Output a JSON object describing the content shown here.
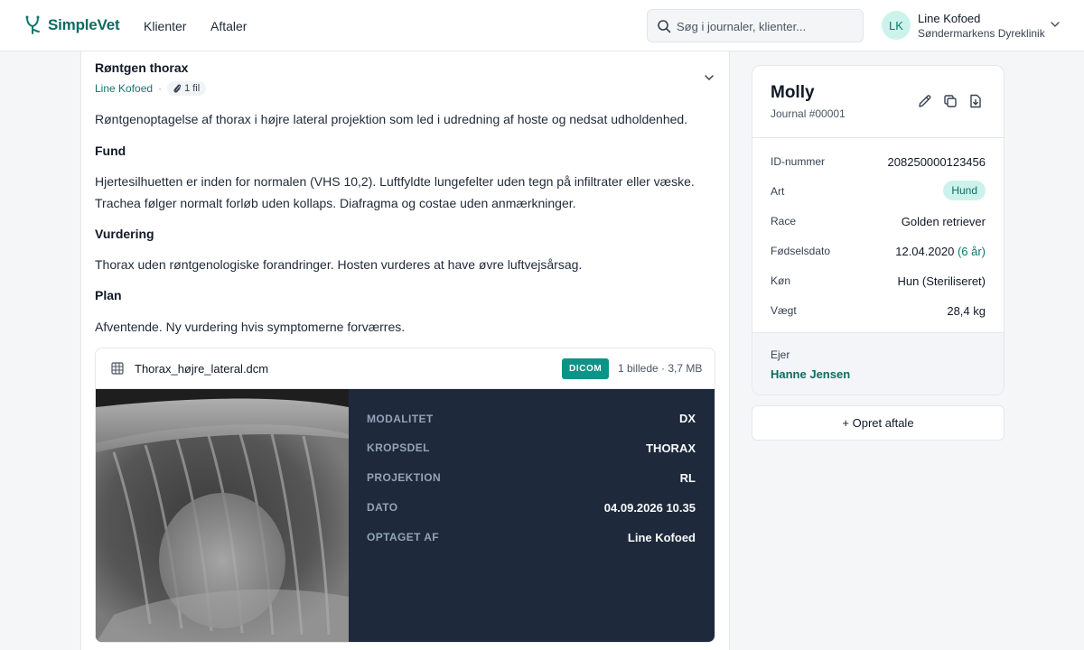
{
  "app": {
    "name": "SimpleVet",
    "nav": [
      {
        "label": "Klienter"
      },
      {
        "label": "Aftaler"
      }
    ]
  },
  "search": {
    "placeholder": "Søg i journaler, klienter..."
  },
  "user": {
    "initials": "LK",
    "name": "Line Kofoed",
    "clinic": "Søndermarkens Dyreklinik"
  },
  "entry": {
    "title": "Røntgen thorax",
    "author": "Line Kofoed",
    "separator": "·",
    "files_label": "1 fil",
    "intro": "Røntgenoptagelse af thorax i højre lateral projektion som led i udredning af hoste og nedsat udholdenhed.",
    "sections": [
      {
        "heading": "Fund",
        "lines": [
          "Hjertesilhuetten er inden for normalen (VHS 10,2). Luftfyldte lungefelter uden tegn på infiltrater eller væske.",
          "Trachea følger normalt forløb uden kollaps. Diafragma og costae uden anmærkninger."
        ]
      },
      {
        "heading": "Vurdering",
        "lines": [
          "Thorax uden røntgenologiske forandringer. Hosten vurderes at have øvre luftvejsårsag."
        ]
      },
      {
        "heading": "Plan",
        "lines": [
          "Afventende. Ny vurdering hvis symptomerne forværres."
        ]
      }
    ],
    "attachment": {
      "filename": "Thorax_højre_lateral.dcm",
      "badge": "DICOM",
      "info": "1 billede · 3,7 MB",
      "metadata": [
        {
          "label": "MODALITET",
          "value": "DX"
        },
        {
          "label": "KROPSDEL",
          "value": "THORAX"
        },
        {
          "label": "PROJEKTION",
          "value": "RL"
        },
        {
          "label": "DATO",
          "value": "04.09.2026 10.35"
        },
        {
          "label": "OPTAGET AF",
          "value": "Line Kofoed"
        }
      ]
    }
  },
  "patient": {
    "name": "Molly",
    "journal": "Journal #00001",
    "fields": {
      "id": {
        "label": "ID-nummer",
        "value": "208250000123456"
      },
      "species": {
        "label": "Art",
        "value": "Hund"
      },
      "breed": {
        "label": "Race",
        "value": "Golden retriever"
      },
      "dob": {
        "label": "Fødselsdato",
        "value": "12.04.2020",
        "age": "(6 år)"
      },
      "sex": {
        "label": "Køn",
        "value": "Hun (Steriliseret)"
      },
      "weight": {
        "label": "Vægt",
        "value": "28,4 kg"
      }
    },
    "owner": {
      "label": "Ejer",
      "name": "Hanne Jensen"
    }
  },
  "actions": {
    "create_appointment": "+ Opret aftale"
  },
  "colors": {
    "brand": "#0f6b61",
    "accent": "#0d9488",
    "badge_bg": "#ccf3eb",
    "dicom_panel": "#1e293b"
  }
}
